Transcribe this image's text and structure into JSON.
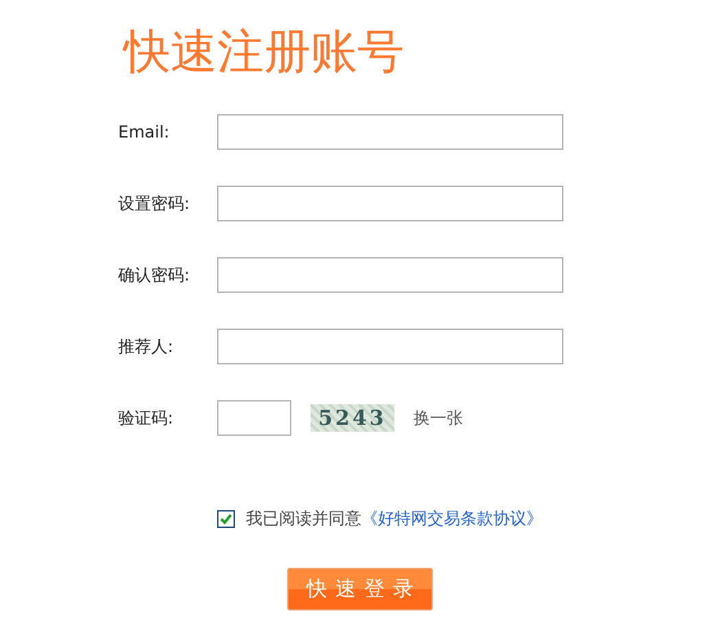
{
  "title": "快速注册账号",
  "fields": [
    {
      "label": "Email:",
      "kind": "text"
    },
    {
      "label": "设置密码:",
      "kind": "password"
    },
    {
      "label": "确认密码:",
      "kind": "password"
    },
    {
      "label": "推荐人:",
      "kind": "text"
    },
    {
      "label": "验证码:",
      "kind": "captcha",
      "captcha": "5243",
      "refresh": "换一张"
    }
  ],
  "agreement": {
    "checked": true,
    "text": "我已阅读并同意",
    "link": "《好特网交易条款协议》"
  },
  "submit": "快速登录"
}
